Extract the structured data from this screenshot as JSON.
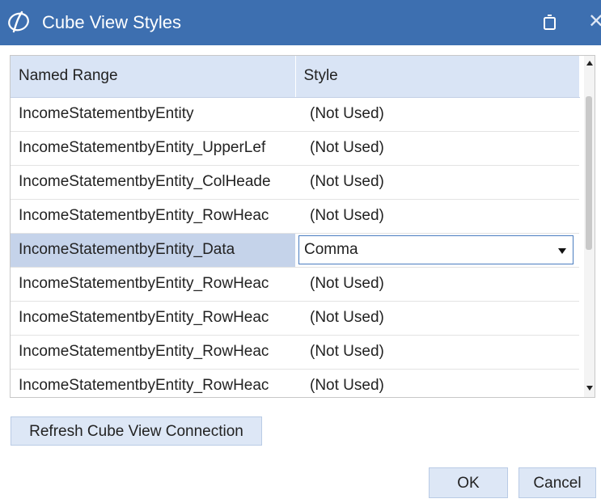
{
  "window": {
    "title": "Cube View Styles",
    "titlebar_color": "#3d6fb0"
  },
  "icons": {
    "app": "app-logo-icon",
    "restore": "restore-icon",
    "close": "close-icon"
  },
  "grid": {
    "columns": [
      "Named Range",
      "Style"
    ],
    "rows": [
      {
        "range": "IncomeStatementbyEntity",
        "style": "(Not Used)"
      },
      {
        "range": "IncomeStatementbyEntity_UpperLef",
        "style": "(Not Used)"
      },
      {
        "range": "IncomeStatementbyEntity_ColHeade",
        "style": "(Not Used)"
      },
      {
        "range": "IncomeStatementbyEntity_RowHeac",
        "style": "(Not Used)"
      },
      {
        "range": "IncomeStatementbyEntity_Data",
        "style": "Comma"
      },
      {
        "range": "IncomeStatementbyEntity_RowHeac",
        "style": "(Not Used)"
      },
      {
        "range": "IncomeStatementbyEntity_RowHeac",
        "style": "(Not Used)"
      },
      {
        "range": "IncomeStatementbyEntity_RowHeac",
        "style": "(Not Used)"
      },
      {
        "range": "IncomeStatementbyEntity_RowHeac",
        "style": "(Not Used)"
      }
    ],
    "header_bg": "#d9e4f5",
    "selected_bg": "#c5d3ea"
  },
  "buttons": {
    "refresh": "Refresh Cube View Connection",
    "ok": "OK",
    "cancel": "Cancel"
  }
}
